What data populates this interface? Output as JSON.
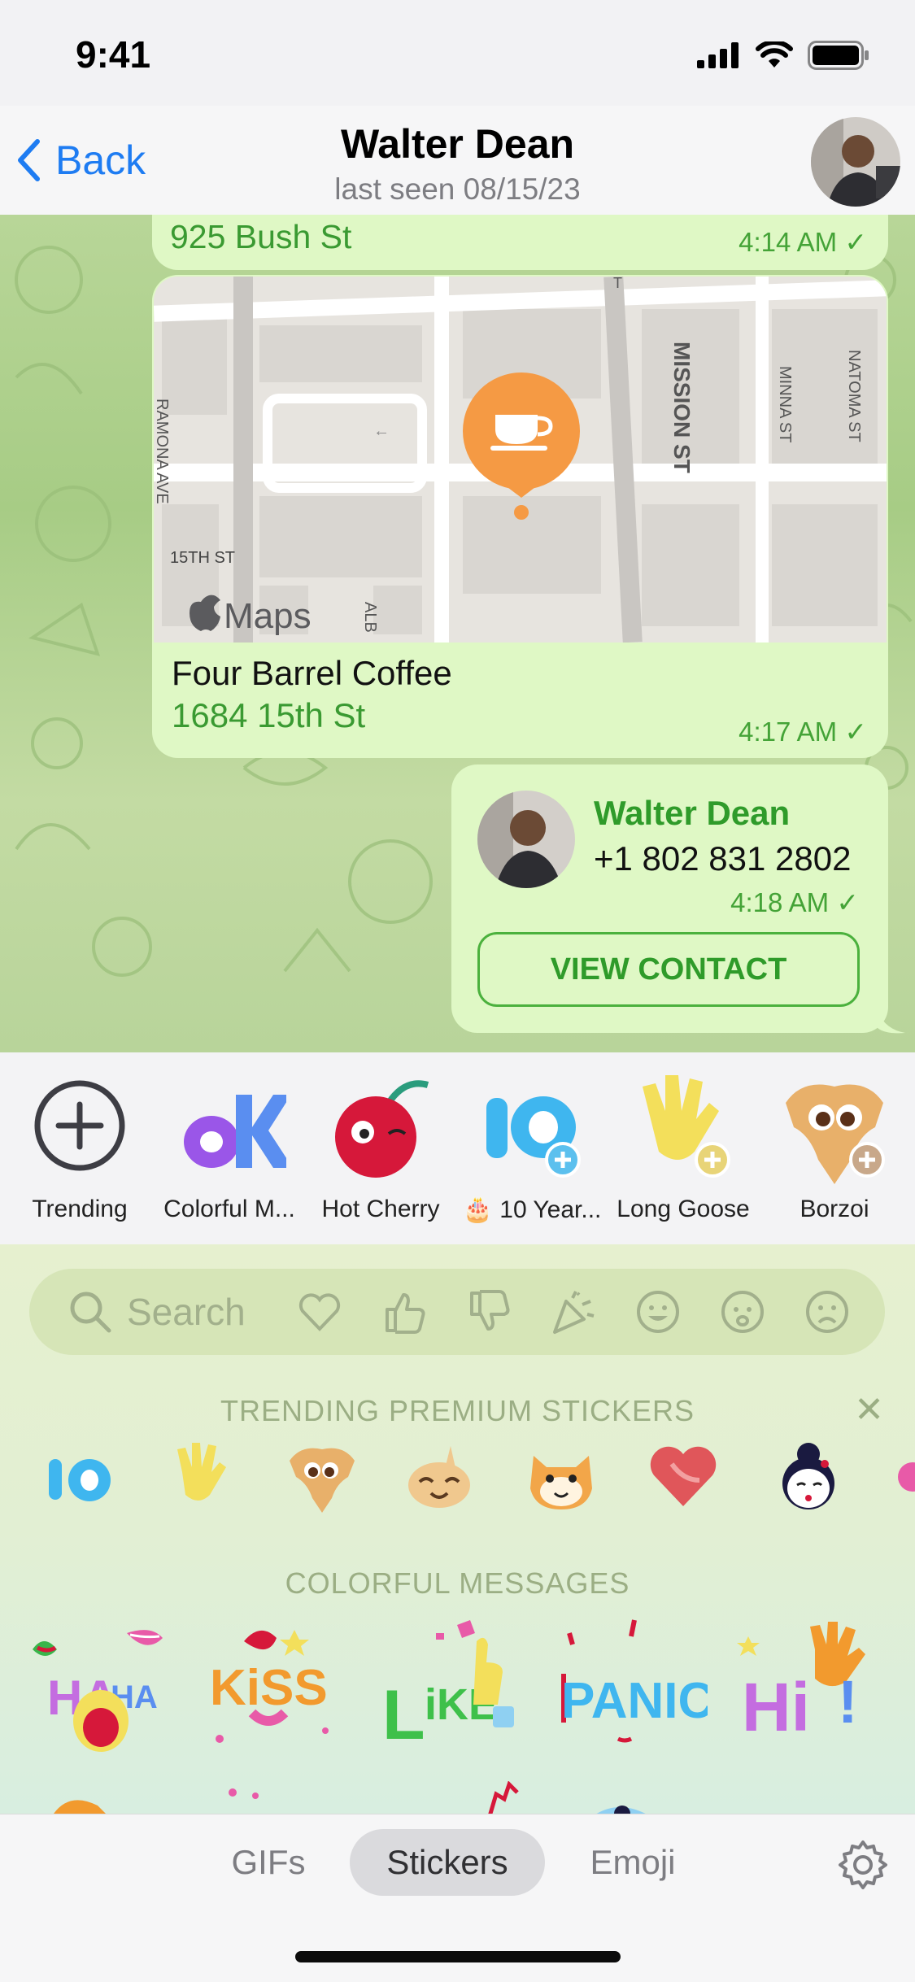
{
  "status": {
    "time": "9:41"
  },
  "nav": {
    "back": "Back",
    "name": "Walter Dean",
    "subtitle": "last seen 08/15/23"
  },
  "messages": {
    "address_top": {
      "text": "925 Bush St",
      "time": "4:14 AM"
    },
    "location": {
      "place": "Four Barrel Coffee",
      "address": "1684 15th St",
      "time": "4:17 AM",
      "maps_logo": "Maps",
      "streets": [
        "MISSION ST",
        "MINNA ST",
        "NATOMA ST",
        "RAMONA AVE",
        "15TH ST",
        "ALB",
        "T"
      ]
    },
    "contact": {
      "name": "Walter Dean",
      "phone": "+1 802 831 2802",
      "time": "4:18 AM",
      "button": "VIEW CONTACT"
    }
  },
  "packs": [
    {
      "label": "Trending"
    },
    {
      "label": "Colorful M..."
    },
    {
      "label": "Hot Cherry"
    },
    {
      "label": "🎂 10 Year..."
    },
    {
      "label": "Long Goose"
    },
    {
      "label": "Borzoi"
    }
  ],
  "search": {
    "placeholder": "Search",
    "emoji_icons": [
      "heart-icon",
      "thumbs-up-icon",
      "thumbs-down-icon",
      "party-popper-icon",
      "smile-icon",
      "worried-icon",
      "sad-icon"
    ]
  },
  "sections": {
    "trending": "TRENDING PREMIUM STICKERS",
    "colorful": "COLORFUL MESSAGES",
    "close": "✕"
  },
  "tabs": {
    "gifs": "GIFs",
    "stickers": "Stickers",
    "emoji": "Emoji",
    "active": "Stickers"
  },
  "colors": {
    "accent": "#1e7cf2",
    "bubble": "#dff8c5",
    "bubble_text": "#3a9a32",
    "map_pin": "#f59a44"
  }
}
